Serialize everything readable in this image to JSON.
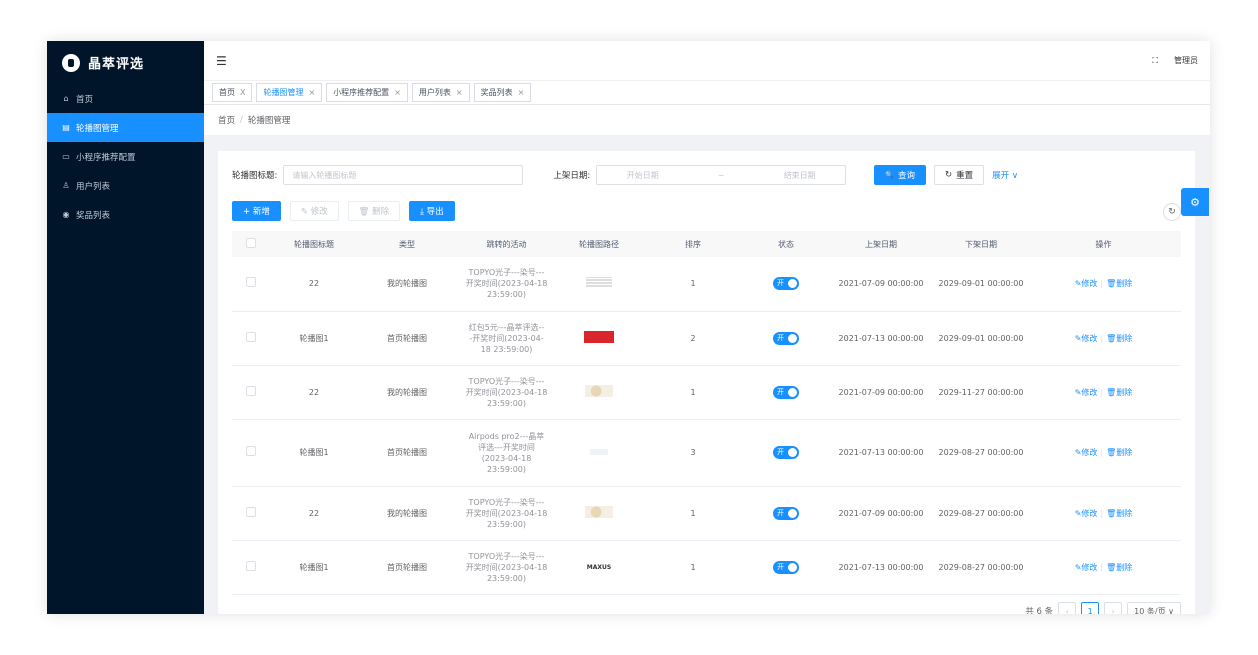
{
  "sidebar": {
    "logo_text": "晶萃评选",
    "items": [
      {
        "icon": "⌂",
        "label": "首页",
        "active": false
      },
      {
        "icon": "▤",
        "label": "轮播图管理",
        "active": true
      },
      {
        "icon": "▭",
        "label": "小程序推荐配置",
        "active": false
      },
      {
        "icon": "♙",
        "label": "用户列表",
        "active": false
      },
      {
        "icon": "◉",
        "label": "奖品列表",
        "active": false
      }
    ]
  },
  "topbar": {
    "hamburger_icon": "☰",
    "fullscreen_icon": "⛶",
    "user_label": "管理员"
  },
  "tabs": [
    {
      "label": "首页",
      "close": "X",
      "active": false
    },
    {
      "label": "轮播图管理",
      "close": "×",
      "active": true
    },
    {
      "label": "小程序推荐配置",
      "close": "×",
      "active": false
    },
    {
      "label": "用户列表",
      "close": "×",
      "active": false
    },
    {
      "label": "奖品列表",
      "close": "×",
      "active": false
    }
  ],
  "breadcrumb": {
    "home": "首页",
    "sep": "/",
    "current": "轮播图管理"
  },
  "search": {
    "title_label": "轮播图标题:",
    "title_placeholder": "请输入轮播图标题",
    "date_label": "上架日期:",
    "start_placeholder": "开始日期",
    "range_sep": "~",
    "end_placeholder": "结束日期",
    "query_label": "查询",
    "query_icon": "🔍",
    "reset_label": "重置",
    "reset_icon": "↻",
    "expand_label": "展开 ∨"
  },
  "toolbar": {
    "add_label": "+ 新增",
    "edit_label": "✎ 修改",
    "delete_label": "🗑 删除",
    "export_label": "⤓ 导出"
  },
  "refresh_icon": "↻",
  "settings_icon": "⚙",
  "table": {
    "columns": [
      "轮播图标题",
      "类型",
      "跳转的活动",
      "轮播图路径",
      "排序",
      "状态",
      "上架日期",
      "下架日期",
      "操作"
    ],
    "rows": [
      {
        "title": "22",
        "type": "我的轮播图",
        "activity": [
          "TOPYO光子---染号---",
          "开奖时间(2023-04-18",
          "23:59:00)"
        ],
        "thumb": "t1",
        "thumb_text": "",
        "sort": "1",
        "status": "开",
        "start": "2021-07-09 00:00:00",
        "end": "2029-09-01 00:00:00"
      },
      {
        "title": "轮播图1",
        "type": "首页轮播图",
        "activity": [
          "红包5元---晶萃评选--",
          "-开奖时间(2023-04-",
          "18 23:59:00)"
        ],
        "thumb": "t2",
        "thumb_text": "",
        "sort": "2",
        "status": "开",
        "start": "2021-07-13 00:00:00",
        "end": "2029-09-01 00:00:00"
      },
      {
        "title": "22",
        "type": "我的轮播图",
        "activity": [
          "TOPYO光子---染号---",
          "开奖时间(2023-04-18",
          "23:59:00)"
        ],
        "thumb": "t3",
        "thumb_text": "",
        "sort": "1",
        "status": "开",
        "start": "2021-07-09 00:00:00",
        "end": "2029-11-27 00:00:00"
      },
      {
        "title": "轮播图1",
        "type": "首页轮播图",
        "activity": [
          "Airpods pro2---晶萃",
          "评选---开奖时间",
          "(2023-04-18",
          "23:59:00)"
        ],
        "thumb": "t4",
        "thumb_text": "",
        "sort": "3",
        "status": "开",
        "start": "2021-07-13 00:00:00",
        "end": "2029-08-27 00:00:00"
      },
      {
        "title": "22",
        "type": "我的轮播图",
        "activity": [
          "TOPYO光子---染号---",
          "开奖时间(2023-04-18",
          "23:59:00)"
        ],
        "thumb": "t3",
        "thumb_text": "",
        "sort": "1",
        "status": "开",
        "start": "2021-07-09 00:00:00",
        "end": "2029-08-27 00:00:00"
      },
      {
        "title": "轮播图1",
        "type": "首页轮播图",
        "activity": [
          "TOPYO光子---染号---",
          "开奖时间(2023-04-18",
          "23:59:00)"
        ],
        "thumb": "t5",
        "thumb_text": "MAXUS",
        "sort": "1",
        "status": "开",
        "start": "2021-07-13 00:00:00",
        "end": "2029-08-27 00:00:00"
      }
    ],
    "edit_action": "✎修改",
    "delete_action": "🗑删除"
  },
  "pagination": {
    "total": "共 6 条",
    "prev": "‹",
    "page": "1",
    "next": "›",
    "page_size": "10 条/页 ∨"
  },
  "colors": {
    "primary": "#1890ff",
    "sidebar_bg": "#001529"
  }
}
